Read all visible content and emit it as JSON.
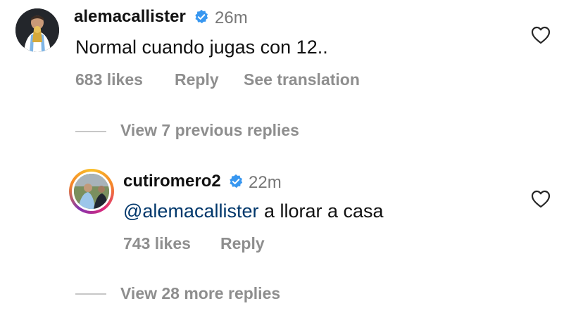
{
  "comment": {
    "username": "alemacallister",
    "time": "26m",
    "text": "Normal cuando jugas con 12..",
    "likes": "683 likes",
    "reply": "Reply",
    "translate": "See translation"
  },
  "view_previous": "View 7 previous replies",
  "reply_comment": {
    "username": "cutiromero2",
    "time": "22m",
    "mention": "@alemacallister",
    "text": " a llorar a casa",
    "likes": "743 likes",
    "reply": "Reply"
  },
  "view_more": "View 28 more replies",
  "icons": {
    "verified": "verified-badge-icon",
    "like": "heart-icon"
  },
  "colors": {
    "verified": "#3897f0",
    "mention": "#00376b",
    "secondary_text": "#8e8e8e"
  }
}
